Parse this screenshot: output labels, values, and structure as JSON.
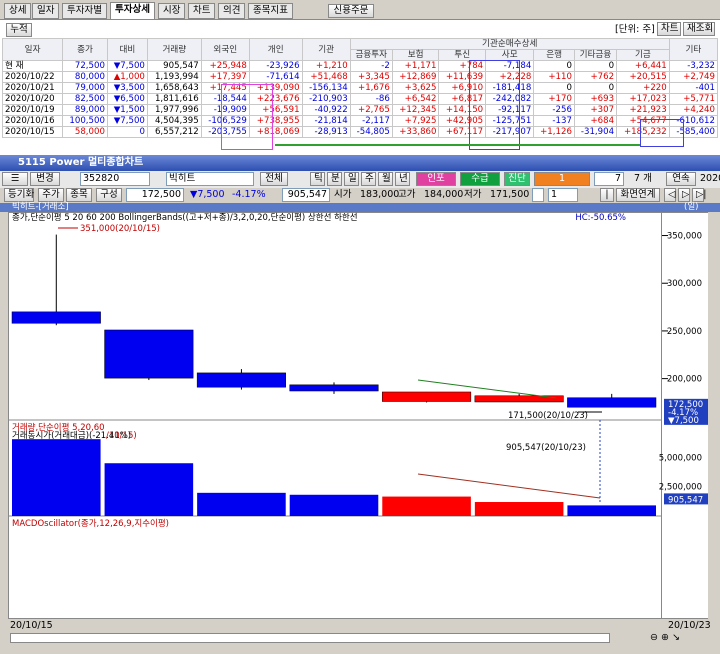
{
  "tabs": [
    "상세",
    "일자",
    "투자자별",
    "투자상세",
    "시장",
    "차트",
    "의견",
    "종목지표"
  ],
  "credit_order": "신용주문",
  "accumulate": "누적",
  "unit": "[단위: 주]",
  "chart_btn": "차트",
  "lookup_btn": "재조회",
  "table": {
    "headers": [
      "일자",
      "종가",
      "대비",
      "거래량",
      "외국인",
      "개인",
      "기관"
    ],
    "inst_header": "기관순매수상세",
    "inst_sub": [
      "금융투자",
      "보험",
      "투신",
      "사모",
      "은행",
      "기타금융",
      "기금"
    ],
    "last_header": "기타",
    "rows": [
      [
        "현 재",
        "72,500",
        "7,500",
        "905,547",
        "+25,948",
        "-23,926",
        "+1,210",
        "-2",
        "+1,171",
        "+784",
        "-7,184",
        "0",
        "0",
        "+6,441",
        "-3,232"
      ],
      [
        "2020/10/22",
        "80,000",
        "1,000",
        "1,193,994",
        "+17,397",
        "-71,614",
        "+51,468",
        "+3,345",
        "+12,869",
        "+11,639",
        "+2,228",
        "+110",
        "+762",
        "+20,515",
        "+2,749"
      ],
      [
        "2020/10/21",
        "79,000",
        "3,500",
        "1,658,643",
        "+17,445",
        "+139,090",
        "-156,134",
        "+1,676",
        "+3,625",
        "+6,910",
        "-181,418",
        "0",
        "0",
        "+220",
        "-401"
      ],
      [
        "2020/10/20",
        "82,500",
        "6,500",
        "1,811,616",
        "-18,544",
        "+223,676",
        "-210,903",
        "-86",
        "+6,542",
        "+6,817",
        "-242,082",
        "+170",
        "+693",
        "+17,023",
        "+5,771"
      ],
      [
        "2020/10/19",
        "89,000",
        "1,500",
        "1,977,996",
        "-19,909",
        "+56,591",
        "-40,922",
        "+2,765",
        "+12,345",
        "+14,150",
        "-92,117",
        "-256",
        "+307",
        "+21,923",
        "+4,240"
      ],
      [
        "2020/10/16",
        "100,500",
        "7,500",
        "4,504,395",
        "-106,529",
        "+738,955",
        "-21,814",
        "-2,117",
        "+7,925",
        "+42,905",
        "-125,751",
        "-137",
        "+684",
        "+54,677",
        "-610,612"
      ],
      [
        "2020/10/15",
        "58,000",
        "0",
        "6,557,212",
        "-203,755",
        "+818,069",
        "-28,913",
        "-54,805",
        "+33,860",
        "+67,117",
        "-217,907",
        "+1,126",
        "-31,904",
        "+185,232",
        "-585,400"
      ]
    ],
    "dir": [
      "",
      "down",
      "down",
      "down",
      "down",
      "down",
      ""
    ]
  },
  "window_title": "5115 Power 멀티종합차트",
  "toolbar": {
    "code": "352820",
    "name": "빅히트",
    "whole": "전체",
    "period_btns": [
      "틱",
      "분",
      "일",
      "주",
      "월",
      "년"
    ],
    "invest": "인포",
    "sum": "수급",
    "diag": "진단",
    "num": "1",
    "date_val": "7",
    "date_unit": "7 개",
    "conn": "연속",
    "year": "2020"
  },
  "row2": {
    "b1": "등기화",
    "b2": "주가",
    "b3": "종목",
    "b4": "구성",
    "price": "172,500",
    "chg": "7,500",
    "pct": "-4.17%",
    "vol": "905,547",
    "open_lbl": "시가",
    "open": "183,000",
    "high_lbl": "고가",
    "high": "184,000",
    "low_lbl": "저가",
    "low": "171,500",
    "spin": "1",
    "view": "화면연계"
  },
  "chart_header": "빅히트-[거래소]",
  "min_label": "(일)",
  "price_panel": {
    "title": "종가,단순이평 5 20 60 200 BollingerBands((고+저+종)/3,2,0,20,단순이평) 상한선 하한선",
    "hc": "HC:-50.65%",
    "hi_label": "351,000(20/10/15)",
    "lo_label": "171,500(20/10/23)"
  },
  "vol_panel": {
    "title": "거래량,단순이평 5,20,60",
    "title2": "거래동시가(거래대금)(-21.41%)",
    "hi": "/10/15)",
    "last_label": "905,547(20/10/23)"
  },
  "macd_panel": {
    "title": "MACDOscillator(종가,12,26,9,지수이평)"
  },
  "badges": {
    "price": "172,500",
    "chg": "-4.17%",
    "chg2": "▼7,500",
    "vol": "905,547"
  },
  "dates": {
    "start": "20/10/15",
    "end": "20/10/23"
  },
  "chart_data": {
    "type": "candlestick",
    "x": [
      "20/10/15",
      "20/10/16",
      "20/10/19",
      "20/10/20",
      "20/10/21",
      "20/10/22",
      "20/10/23"
    ],
    "open": [
      270000,
      251000,
      206000,
      193500,
      176000,
      175500,
      180000
    ],
    "close": [
      258000,
      200500,
      191000,
      187000,
      186000,
      182000,
      170000
    ],
    "high": [
      351000,
      251000,
      210000,
      196000,
      186000,
      184000,
      184000
    ],
    "low": [
      256000,
      198500,
      188500,
      184000,
      175000,
      175500,
      171500
    ],
    "volume": [
      6557212,
      4504395,
      1977996,
      1811616,
      1658643,
      1193994,
      905547
    ],
    "y_ticks": [
      350000,
      300000,
      250000,
      200000
    ],
    "vol_ticks": [
      5000000,
      2500000
    ],
    "ylim": [
      165000,
      360000
    ]
  }
}
